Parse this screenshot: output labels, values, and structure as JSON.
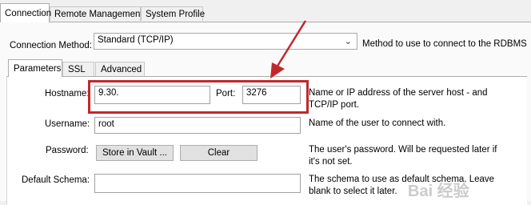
{
  "tabs": [
    {
      "label": "Connection",
      "active": true
    },
    {
      "label": "Remote Management",
      "active": false
    },
    {
      "label": "System Profile",
      "active": false
    }
  ],
  "connection_method": {
    "label": "Connection Method:",
    "value": "Standard (TCP/IP)",
    "description": "Method to use to connect to the RDBMS"
  },
  "subtabs": [
    {
      "label": "Parameters",
      "active": true
    },
    {
      "label": "SSL",
      "active": false
    },
    {
      "label": "Advanced",
      "active": false
    }
  ],
  "hostname": {
    "label": "Hostname:",
    "value": "9.30.",
    "description": "Name or IP address of the server host - and TCP/IP port."
  },
  "port": {
    "label": "Port:",
    "value": "3276"
  },
  "username": {
    "label": "Username:",
    "value": "root",
    "description": "Name of the user to connect with."
  },
  "password": {
    "label": "Password:",
    "store_button": "Store in Vault ...",
    "clear_button": "Clear",
    "description": "The user's password. Will be requested later if it's not set."
  },
  "default_schema": {
    "label": "Default Schema:",
    "value": "",
    "description": "The schema to use as default schema. Leave blank to select it later."
  },
  "annotation": {
    "color": "#c0282d"
  },
  "watermark": "Bai 经验"
}
